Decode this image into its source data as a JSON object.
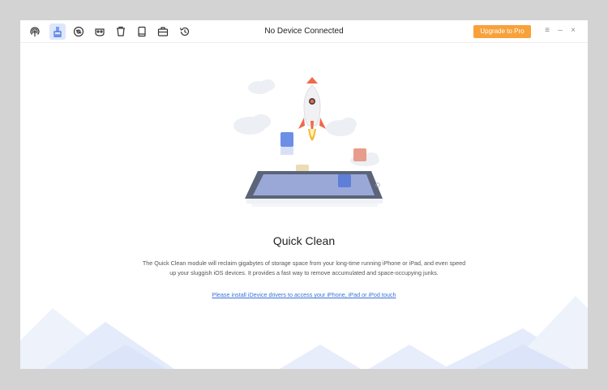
{
  "toolbar": {
    "icons": [
      {
        "name": "airdrop-icon"
      },
      {
        "name": "broom-icon"
      },
      {
        "name": "privacy-icon"
      },
      {
        "name": "mask-icon"
      },
      {
        "name": "trash-icon"
      },
      {
        "name": "book-icon"
      },
      {
        "name": "briefcase-icon"
      },
      {
        "name": "history-icon"
      }
    ],
    "active_index": 1
  },
  "window": {
    "title": "No Device Connected",
    "upgrade_label": "Upgrade to Pro",
    "menu_glyph": "≡",
    "minimize_glyph": "–",
    "close_glyph": "×"
  },
  "main": {
    "heading": "Quick Clean",
    "description_line1": "The Quick Clean module will reclaim gigabytes of storage space from your long-time running iPhone or iPad, and even speed",
    "description_line2": "up your sluggish iOS devices. It provides a fast way to remove accumulated and space-occupying junks.",
    "install_link": "Please install iDevice drivers to access your iPhone, iPad or iPod touch"
  },
  "colors": {
    "accent": "#f8a13a",
    "link": "#3b6fd9",
    "active_tab": "#dde6fb"
  }
}
